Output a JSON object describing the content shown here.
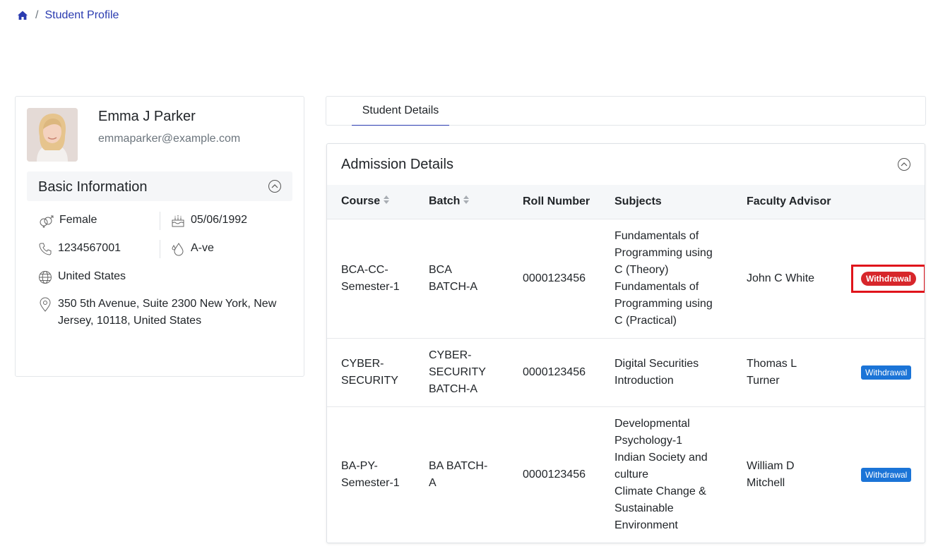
{
  "breadcrumb": {
    "home_icon": "home-icon",
    "separator": "/",
    "current": "Student Profile"
  },
  "profile": {
    "name": "Emma J Parker",
    "email": "emmaparker@example.com",
    "basic_info_title": "Basic Information",
    "gender": "Female",
    "dob": "05/06/1992",
    "phone": "1234567001",
    "blood_group": "A-ve",
    "country": "United States",
    "address": "350 5th Avenue, Suite 2300 New York, New Jersey, 10118, United States"
  },
  "tabs": [
    {
      "label": "Student Details",
      "active": true
    }
  ],
  "admission": {
    "title": "Admission Details",
    "columns": [
      "Course",
      "Batch",
      "Roll Number",
      "Subjects",
      "Faculty Advisor"
    ],
    "rows": [
      {
        "course": "BCA-CC-Semester-1",
        "batch": "BCA BATCH-A",
        "roll": "0000123456",
        "subjects": [
          "Fundamentals of Programming using C (Theory)",
          "Fundamentals of Programming using C (Practical)"
        ],
        "advisor": "John C White",
        "action": "Withdrawal"
      },
      {
        "course": "CYBER-SECURITY",
        "batch": "CYBER-SECURITY BATCH-A",
        "roll": "0000123456",
        "subjects": [
          "Digital Securities Introduction"
        ],
        "advisor": "Thomas L Turner",
        "action": "Withdrawal"
      },
      {
        "course": "BA-PY-Semester-1",
        "batch": "BA BATCH-A",
        "roll": "0000123456",
        "subjects": [
          "Developmental Psychology-1",
          "Indian Society and culture",
          "Climate Change & Sustainable Environment"
        ],
        "advisor": "William D Mitchell",
        "action": "Withdrawal"
      }
    ]
  },
  "colors": {
    "link": "#2a3bb0",
    "badge_blue": "#1b74d7",
    "badge_red": "#d7262b",
    "highlight": "#e0141b"
  }
}
